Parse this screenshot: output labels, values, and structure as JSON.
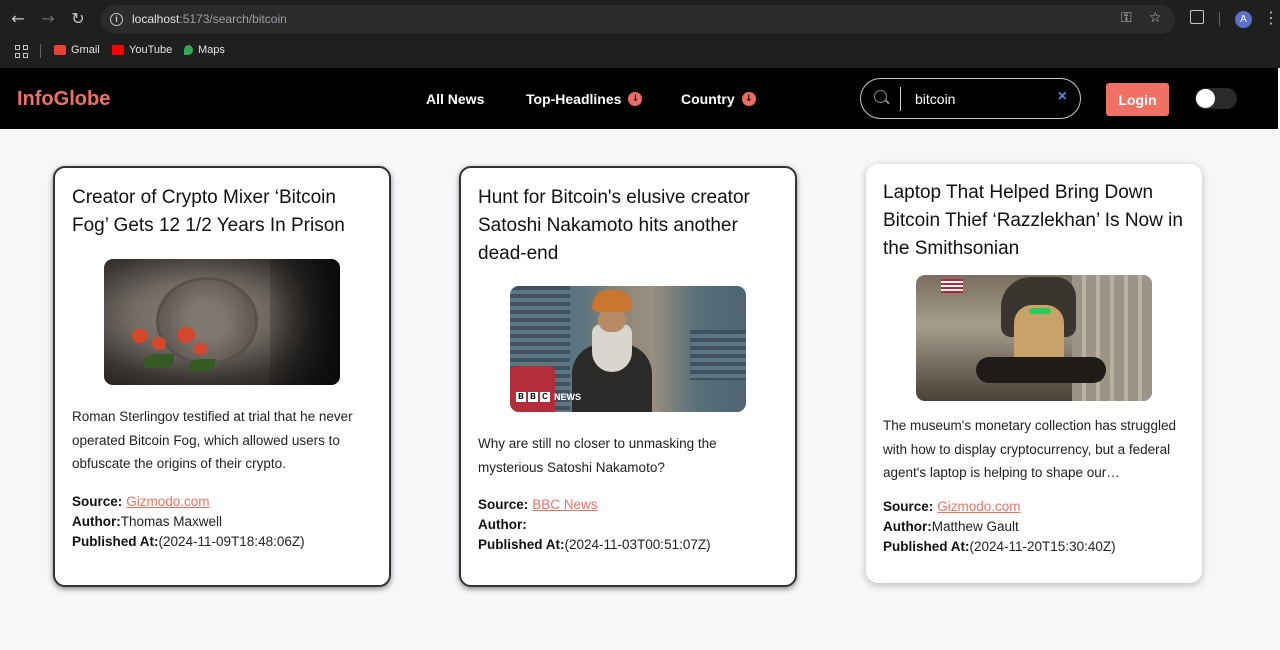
{
  "browser": {
    "url_host": "localhost",
    "url_rest": ":5173/search/bitcoin",
    "bookmarks": [
      {
        "label": "Gmail",
        "icon": "gmail-icon",
        "color": "#ea4335"
      },
      {
        "label": "YouTube",
        "icon": "youtube-icon",
        "color": "#ff0000"
      },
      {
        "label": "Maps",
        "icon": "maps-icon",
        "color": "#34a853"
      }
    ],
    "avatar_letter": "A"
  },
  "navbar": {
    "brand": "InfoGlobe",
    "links": {
      "all_news": "All News",
      "top_headlines": "Top-Headlines",
      "country": "Country"
    },
    "search_value": "bitcoin",
    "login_label": "Login",
    "accent_color": "#f07164"
  },
  "articles": [
    {
      "title": "Creator of Crypto Mixer ‘Bitcoin Fog’ Gets 12 1/2 Years In Prison",
      "description": "Roman Sterlingov testified at trial that he never operated Bitcoin Fog, which allowed users to obfuscate the origins of their crypto.",
      "source_label": "Source:",
      "source": "Gizmodo.com",
      "author_label": "Author:",
      "author": "Thomas Maxwell",
      "published_label": "Published At:",
      "published": "(2024-11-09T18:48:06Z)"
    },
    {
      "title": "Hunt for Bitcoin's elusive creator Satoshi Nakamoto hits another dead-end",
      "description": "Why are still no closer to unmasking the mysterious Satoshi Nakamoto?",
      "source_label": "Source:",
      "source": "BBC News",
      "author_label": "Author:",
      "author": "",
      "published_label": "Published At:",
      "published": "(2024-11-03T00:51:07Z)",
      "image_caption": "NEWS"
    },
    {
      "title": "Laptop That Helped Bring Down Bitcoin Thief ‘Razzlekhan’ Is Now in the Smithsonian",
      "description": "The museum's monetary collection has struggled with how to display cryptocurrency, but a federal agent's laptop is helping to shape our…",
      "source_label": "Source:",
      "source": "Gizmodo.com",
      "author_label": "Author:",
      "author": "Matthew Gault",
      "published_label": "Published At:",
      "published": "(2024-11-20T15:30:40Z)"
    }
  ]
}
